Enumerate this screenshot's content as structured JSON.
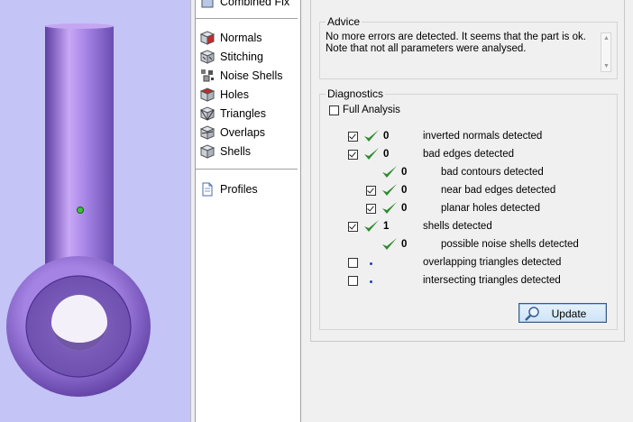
{
  "nav": {
    "partial_top_item": "Combined Fix",
    "items": [
      {
        "label": "Normals",
        "icon": "normals-icon"
      },
      {
        "label": "Stitching",
        "icon": "stitching-icon"
      },
      {
        "label": "Noise Shells",
        "icon": "noise-shells-icon"
      },
      {
        "label": "Holes",
        "icon": "holes-icon"
      },
      {
        "label": "Triangles",
        "icon": "triangles-icon"
      },
      {
        "label": "Overlaps",
        "icon": "overlaps-icon"
      },
      {
        "label": "Shells",
        "icon": "shells-icon"
      }
    ],
    "profiles": {
      "label": "Profiles",
      "icon": "document-icon"
    }
  },
  "advice": {
    "title": "Advice",
    "line1": "No more errors are detected. It seems that the part is ok.",
    "line2": "Note that not all parameters were analysed."
  },
  "diagnostics": {
    "title": "Diagnostics",
    "full_analysis_label": "Full Analysis",
    "full_analysis_checked": false,
    "rows": [
      {
        "checked": true,
        "has_checkbox": true,
        "status": "ok",
        "count": "0",
        "label": "inverted normals detected",
        "indent": 0
      },
      {
        "checked": true,
        "has_checkbox": true,
        "status": "ok",
        "count": "0",
        "label": "bad edges detected",
        "indent": 0
      },
      {
        "checked": false,
        "has_checkbox": false,
        "status": "ok",
        "count": "0",
        "label": "bad contours detected",
        "indent": 1
      },
      {
        "checked": true,
        "has_checkbox": true,
        "status": "ok",
        "count": "0",
        "label": "near bad edges detected",
        "indent": 1
      },
      {
        "checked": true,
        "has_checkbox": true,
        "status": "ok",
        "count": "0",
        "label": "planar holes detected",
        "indent": 1
      },
      {
        "checked": true,
        "has_checkbox": true,
        "status": "ok",
        "count": "1",
        "label": "shells detected",
        "indent": 0
      },
      {
        "checked": false,
        "has_checkbox": false,
        "status": "ok",
        "count": "0",
        "label": "possible noise shells detected",
        "indent": 1
      },
      {
        "checked": false,
        "has_checkbox": true,
        "status": "pending",
        "count": "",
        "label": "overlapping triangles detected",
        "indent": 0
      },
      {
        "checked": false,
        "has_checkbox": true,
        "status": "pending",
        "count": "",
        "label": "intersecting triangles detected",
        "indent": 0
      }
    ],
    "update_label": "Update"
  },
  "colors": {
    "viewport_bg": "#c4c4f6",
    "part_color": "#9b7fd6",
    "check_green": "#2e8b2e",
    "pending_dot": "#1a40c0"
  }
}
